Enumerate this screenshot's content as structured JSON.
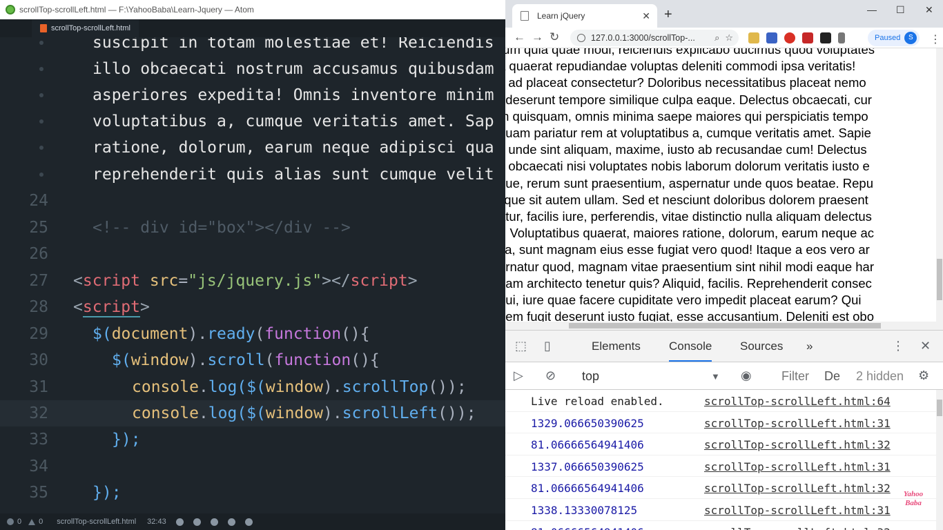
{
  "atom": {
    "window_title": "scrollTop-scrollLeft.html — F:\\YahooBaba\\Learn-Jquery — Atom",
    "tab_label": "scrollTop-scrollLeft.html",
    "prose_lines": [
      "suscipit in totam molestiae et! Reiciendis",
      "illo obcaecati nostrum accusamus quibusdam",
      "asperiores expedita! Omnis inventore minim",
      "voluptatibus a, cumque veritatis amet. Sap",
      "ratione, dolorum, earum neque adipisci qua",
      "reprehenderit quis alias sunt cumque velit"
    ],
    "line_numbers": [
      "24",
      "25",
      "26",
      "27",
      "28",
      "29",
      "30",
      "31",
      "32",
      "33",
      "34",
      "35"
    ],
    "code": {
      "l25": "<!-- div id=\"box\"></div -->",
      "l27_tag": "script",
      "l27_attr": "src",
      "l27_val": "\"js/jquery.js\"",
      "l27_close": "script",
      "l28_tag": "script",
      "l29": [
        "$(",
        "document",
        ").",
        "ready",
        "(",
        "function",
        "(){"
      ],
      "l30": [
        "$(",
        "window",
        ").",
        "scroll",
        "(",
        "function",
        "(){"
      ],
      "l31": [
        "console",
        ".",
        "log",
        "($(",
        "window",
        ").",
        "scrollTop",
        "());"
      ],
      "l32": [
        "console",
        ".",
        "log",
        "($(",
        "window",
        ").",
        "scrollLeft",
        "());"
      ],
      "l33": "});",
      "l35": "});"
    },
    "status": {
      "errors": "0",
      "warnings": "0",
      "file": "scrollTop-scrollLeft.html",
      "cursor": "32:43"
    }
  },
  "chrome": {
    "tab_title": "Learn jQuery",
    "url": "127.0.0.1:3000/scrollTop-...",
    "paused_label": "Paused",
    "profile_initial": "S",
    "page_lines": [
      "rum quia quae modi, reiciendis explicabo ducimus quod voluptates",
      "a quaerat repudiandae voluptas deleniti commodi ipsa veritatis!",
      "s ad placeat consectetur? Doloribus necessitatibus placeat nemo",
      ", deserunt tempore similique culpa eaque. Delectus obcaecati, cur",
      "m quisquam, omnis minima saepe maiores qui perspiciatis tempo",
      "quam pariatur rem at voluptatibus a, cumque veritatis amet. Sapie",
      "s unde sint aliquam, maxime, iusto ab recusandae cum! Delectus",
      "s obcaecati nisi voluptates nobis laborum dolorum veritatis iusto e",
      "que, rerum sunt praesentium, aspernatur unde quos beatae. Repu",
      "lique sit autem ullam. Sed et nesciunt doloribus dolorem praesent",
      "atur, facilis iure, perferendis, vitae distinctio nulla aliquam delectus",
      "r! Voluptatibus quaerat, maiores ratione, dolorum, earum neque ac",
      "tia, sunt magnam eius esse fugiat vero quod! Itaque a eos vero ar",
      "ernatur quod, magnam vitae praesentium sint nihil modi eaque har",
      "uam architecto tenetur quis? Aliquid, facilis. Reprehenderit consec",
      "qui, iure quae facere cupiditate vero impedit placeat earum? Qui",
      "nem fugit deserunt iusto fugiat, esse accusantium. Deleniti est obo"
    ],
    "devtools": {
      "tabs": [
        "Elements",
        "Console",
        "Sources",
        "»"
      ],
      "context": "top",
      "filter_placeholder": "Filter",
      "levels_label": "De",
      "hidden_count": "2 hidden",
      "messages": [
        {
          "text": "Live reload enabled.",
          "source": "scrollTop-scrollLeft.html:64",
          "type": "plain"
        },
        {
          "text": "1329.066650390625",
          "source": "scrollTop-scrollLeft.html:31",
          "type": "number"
        },
        {
          "text": "81.06666564941406",
          "source": "scrollTop-scrollLeft.html:32",
          "type": "number"
        },
        {
          "text": "1337.066650390625",
          "source": "scrollTop-scrollLeft.html:31",
          "type": "number"
        },
        {
          "text": "81.06666564941406",
          "source": "scrollTop-scrollLeft.html:32",
          "type": "number"
        },
        {
          "text": "1338.13330078125",
          "source": "scrollTop-scrollLeft.html:31",
          "type": "number"
        },
        {
          "text": "81.06666564941406",
          "source": "scrollTop-scrollLeft.html:32",
          "type": "number"
        }
      ]
    }
  },
  "watermark": {
    "line1": "Yahoo",
    "line2": "Baba"
  },
  "colors": {
    "atom_bg": "#1e252b",
    "chrome_accent": "#1a73e8",
    "console_number": "#1a1aa6"
  }
}
